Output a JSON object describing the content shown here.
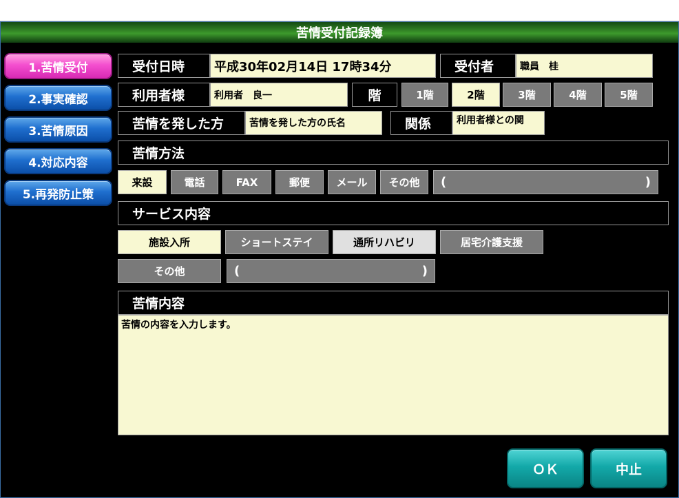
{
  "window": {
    "title": "苦情受付記録簿"
  },
  "sidebar": {
    "items": [
      {
        "label": "1.苦情受付",
        "active": true
      },
      {
        "label": "2.事実確認",
        "active": false
      },
      {
        "label": "3.苦情原因",
        "active": false
      },
      {
        "label": "4.対応内容",
        "active": false
      },
      {
        "label": "5.再発防止策",
        "active": false
      }
    ]
  },
  "reception": {
    "date_label": "受付日時",
    "date_value": "平成30年02月14日 17時34分",
    "receiver_label": "受付者",
    "receiver_value": "職員　桂"
  },
  "user": {
    "label": "利用者様",
    "value": "利用者　良一",
    "floor_label": "階",
    "floors": [
      "1階",
      "2階",
      "3階",
      "4階",
      "5階"
    ],
    "selected_floor": "2階"
  },
  "complainant": {
    "label": "苦情を発した方",
    "value": "苦情を発した方の氏名",
    "relation_label": "関係",
    "relation_value": "利用者様との関"
  },
  "method": {
    "header": "苦情方法",
    "options": [
      "来設",
      "電話",
      "FAX",
      "郵便",
      "メール",
      "その他"
    ],
    "selected": "来設",
    "other_open": "(",
    "other_close": ")"
  },
  "service": {
    "header": "サービス内容",
    "options": [
      "施設入所",
      "ショートステイ",
      "通所リハビリ",
      "居宅介護支援"
    ],
    "selected": "施設入所",
    "other_label": "その他",
    "other_open": "(",
    "other_close": ")"
  },
  "content": {
    "header": "苦情内容",
    "text": "苦情の内容を入力します。"
  },
  "actions": {
    "ok": "ＯＫ",
    "cancel": "中止"
  },
  "colors": {
    "nav_active": "#f44fcf",
    "nav_default": "#1f6fcf",
    "field_bg": "#f8f8d2",
    "option_gray": "#7a7a7a",
    "action_teal": "#13a9a9",
    "title_green": "#2e7a22"
  }
}
